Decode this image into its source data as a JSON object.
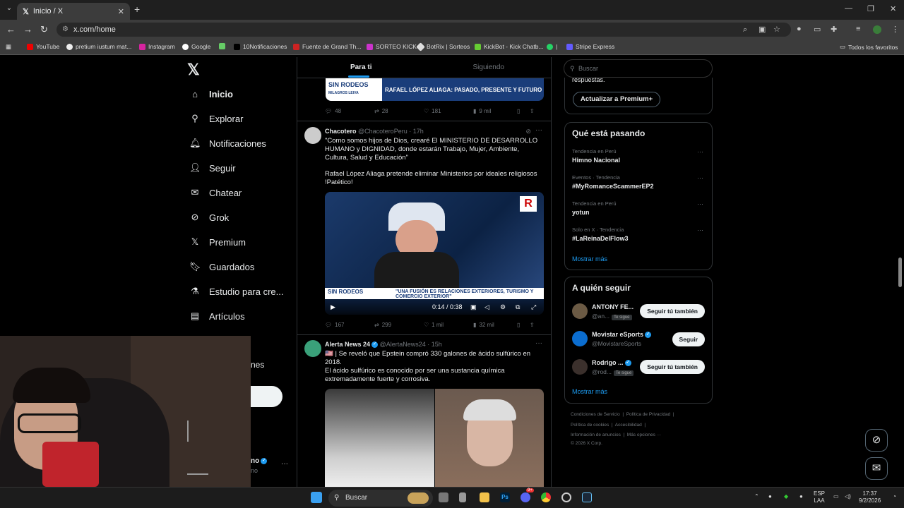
{
  "browser": {
    "tab_title": "Inicio / X",
    "url": "x.com/home",
    "bookmarks": [
      "YouTube",
      "pretium iustum mat...",
      "Instagram",
      "Google",
      "10Notificaciones",
      "Fuente de Grand Th...",
      "SORTEO KICK",
      "BotRix | Sorteos",
      "KickBot - Kick Chatb...",
      "|",
      "Stripe Express"
    ],
    "all_bookmarks": "Todos los favoritos"
  },
  "nav": {
    "items": [
      "Inicio",
      "Explorar",
      "Notificaciones",
      "Seguir",
      "Chatear",
      "Grok",
      "Premium",
      "Guardados",
      "Estudio para cre...",
      "Artículos"
    ],
    "partial_more": "nes",
    "partial_profile": "no"
  },
  "timeline": {
    "tabs": [
      "Para ti",
      "Siguiendo"
    ],
    "banner": {
      "brand": "SIN RODEOS",
      "sub": "MILAGROS LEIVA",
      "headline": "RAFAEL LÓPEZ ALIAGA: PASADO, PRESENTE Y FUTURO"
    },
    "post0_actions": {
      "replies": "48",
      "reposts": "28",
      "likes": "181",
      "views": "9 mil"
    },
    "post1": {
      "name": "Chacotero",
      "handle": "@ChacoteroPeru · 17h",
      "text1": "\"Como somos hijos de Dios, crearé El MINISTERIO DE DESARROLLO HUMANO y DIGNIDAD, donde estarán Trabajo, Mujer, Ambiente, Cultura, Salud y Educación\"",
      "text2": "Rafael López Aliaga pretende eliminar Ministerios por ideales religiosos !Patético!",
      "video_time": "0:14 / 0:38",
      "lower_third": "\"UNA FUSIÓN ES RELACIONES EXTERIORES, TURISMO Y COMERCIO EXTERIOR\"",
      "replies": "167",
      "reposts": "299",
      "likes": "1 mil",
      "views": "32 mil"
    },
    "post2": {
      "name": "Alerta News 24",
      "handle": "@AlertaNews24 · 15h",
      "text1": "🇺🇸 | Se reveló que Epstein compró 330 galones de ácido sulfúrico en 2018.",
      "text2": "El ácido sulfúrico es conocido por ser una sustancia química extremadamente fuerte y corrosiva."
    }
  },
  "right": {
    "search_placeholder": "Buscar",
    "premium_text": "respuestas.",
    "premium_button": "Actualizar a Premium+",
    "trends_title": "Qué está pasando",
    "trends": [
      {
        "meta": "Tendencia en Perú",
        "name": "Himno Nacional"
      },
      {
        "meta": "Eventos · Tendencia",
        "name": "#MyRomanceScammerEP2"
      },
      {
        "meta": "Tendencia en Perú",
        "name": "yotun"
      },
      {
        "meta": "Solo en X · Tendencia",
        "name": "#LaReinaDelFlow3"
      }
    ],
    "show_more": "Mostrar más",
    "follow_title": "A quién seguir",
    "follow": [
      {
        "name": "ANTONY FE...",
        "handle": "@an...",
        "badge": "Te sigue",
        "button": "Seguir tú también"
      },
      {
        "name": "Movistar eSports",
        "handle": "@MovistareSports",
        "badge": "",
        "button": "Seguir"
      },
      {
        "name": "Rodrigo ...",
        "handle": "@rod...",
        "badge": "Te sigue",
        "button": "Seguir tú también"
      }
    ],
    "footer": [
      "Condiciones de Servicio",
      "|",
      "Política de Privacidad",
      "|",
      "Política de cookies",
      "|",
      "Accesibilidad",
      "|",
      "Información de anuncios",
      "|",
      "Más opciones ···",
      "© 2026 X Corp."
    ]
  },
  "taskbar": {
    "search": "Buscar",
    "lang1": "ESP",
    "lang2": "LAA",
    "time": "17:37",
    "date": "9/2/2026",
    "discord_badge": "9+"
  }
}
